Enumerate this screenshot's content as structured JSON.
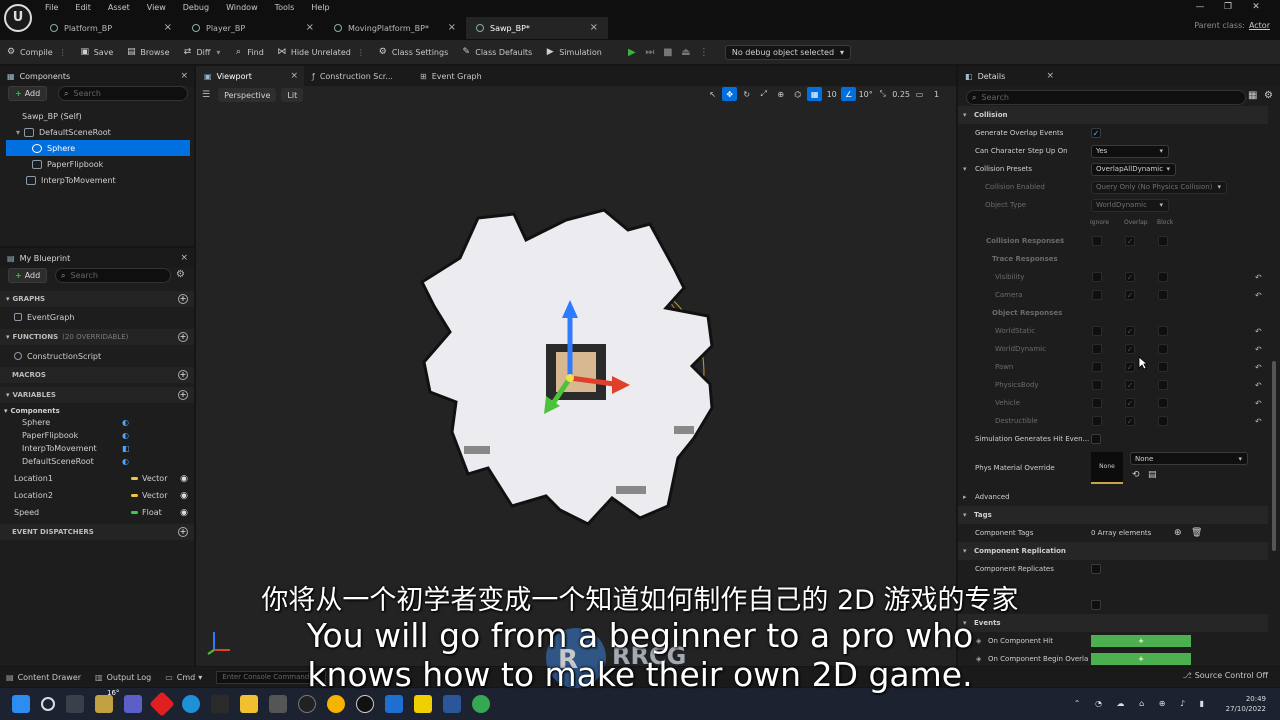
{
  "menu": [
    "File",
    "Edit",
    "Asset",
    "View",
    "Debug",
    "Window",
    "Tools",
    "Help"
  ],
  "doc_tabs": [
    "Platform_BP",
    "Player_BP",
    "MovingPlatform_BP*",
    "Sawp_BP*"
  ],
  "parent_class": {
    "label": "Parent class:",
    "value": "Actor"
  },
  "toolbar": {
    "compile": "Compile",
    "save": "Save",
    "browse": "Browse",
    "diff": "Diff",
    "find": "Find",
    "hide_unrelated": "Hide Unrelated",
    "class_settings": "Class Settings",
    "class_defaults": "Class Defaults",
    "simulation": "Simulation",
    "debug_object": "No debug object selected"
  },
  "components": {
    "tab": "Components",
    "add": "Add",
    "search_placeholder": "Search",
    "tree": [
      {
        "label": "Sawp_BP (Self)"
      },
      {
        "label": "DefaultSceneRoot"
      },
      {
        "label": "Sphere"
      },
      {
        "label": "PaperFlipbook"
      },
      {
        "label": "InterpToMovement"
      }
    ]
  },
  "my_blueprint": {
    "tab": "My Blueprint",
    "add": "Add",
    "search_placeholder": "Search",
    "graphs": "GRAPHS",
    "event_graph": "EventGraph",
    "functions": "FUNCTIONS",
    "functions_note": "(20 OVERRIDABLE)",
    "construction_script": "ConstructionScript",
    "macros": "MACROS",
    "variables": "VARIABLES",
    "components_header": "Components",
    "component_vars": [
      "Sphere",
      "PaperFlipbook",
      "InterpToMovement",
      "DefaultSceneRoot"
    ],
    "vars": [
      {
        "name": "Location1",
        "type": "Vector"
      },
      {
        "name": "Location2",
        "type": "Vector"
      },
      {
        "name": "Speed",
        "type": "Float"
      }
    ],
    "event_dispatchers": "EVENT DISPATCHERS"
  },
  "viewport": {
    "tabs": [
      "Viewport",
      "Construction Scr...",
      "Event Graph"
    ],
    "perspective": "Perspective",
    "lit": "Lit",
    "snap_angle": "10°",
    "snap_scale": "0.25",
    "camera_speed": "1"
  },
  "details": {
    "tab": "Details",
    "search_placeholder": "Search",
    "collision": "Collision",
    "generate_overlap": "Generate Overlap Events",
    "step_up": "Can Character Step Up On",
    "step_up_value": "Yes",
    "presets": "Collision Presets",
    "presets_value": "OverlapAllDynamic",
    "collision_enabled": "Collision Enabled",
    "collision_enabled_value": "Query Only (No Physics Collision)",
    "object_type": "Object Type",
    "object_type_value": "WorldDynamic",
    "col_ignore": "Ignore",
    "col_overlap": "Overlap",
    "col_block": "Block",
    "collision_responses": "Collision Responses",
    "trace_responses": "Trace Responses",
    "visibility": "Visibility",
    "camera": "Camera",
    "object_responses": "Object Responses",
    "objects": [
      "WorldStatic",
      "WorldDynamic",
      "Pawn",
      "PhysicsBody",
      "Vehicle",
      "Destructible"
    ],
    "sim_hit": "Simulation Generates Hit Even...",
    "phys_material": "Phys Material Override",
    "phys_thumb": "None",
    "phys_value": "None",
    "advanced": "Advanced",
    "tags": "Tags",
    "component_tags": "Component Tags",
    "tags_value": "0 Array elements",
    "replication": "Component Replication",
    "replicates": "Component Replicates",
    "events": "Events",
    "on_hit": "On Component Hit",
    "on_overlap": "On Component Begin Overla"
  },
  "bottom": {
    "content_drawer": "Content Drawer",
    "output_log": "Output Log",
    "cmd": "Cmd",
    "console_placeholder": "Enter Console Command",
    "source_control": "Source Control Off"
  },
  "taskbar": {
    "temp": "16°",
    "time": "20:49",
    "date": "27/10/2022"
  },
  "subtitles": {
    "cn": "你将从一个初学者变成一个知道如何制作自己的 2D 游戏的专家",
    "en1": "You will go from a beginner to a pro who",
    "en2": "knows how to make their own 2D game."
  },
  "watermark": "RRCG",
  "colors": {
    "accent": "#0070e0",
    "play": "#3cb043",
    "event_button": "#4caf50",
    "vector_pin": "#f5c242",
    "float_pin": "#35d04a"
  }
}
